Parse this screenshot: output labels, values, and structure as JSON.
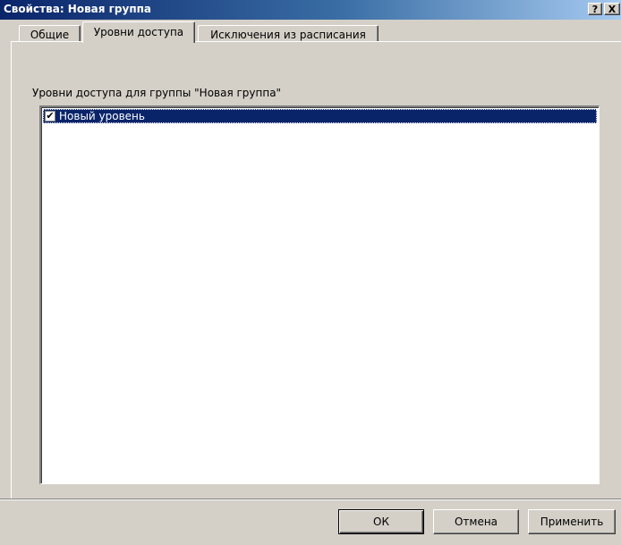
{
  "window": {
    "title": "Свойства: Новая группа",
    "help_label": "?",
    "close_label": "X"
  },
  "tabs": [
    {
      "label": "Общие",
      "active": false
    },
    {
      "label": "Уровни доступа",
      "active": true
    },
    {
      "label": "Исключения из расписания",
      "active": false
    }
  ],
  "panel": {
    "label": "Уровни доступа для группы \"Новая группа\"",
    "items": [
      {
        "label": "Новый уровень",
        "checked": true,
        "selected": true
      }
    ]
  },
  "buttons": {
    "ok": "ОК",
    "cancel": "Отмена",
    "apply": "Применить"
  },
  "colors": {
    "titlebar": "#0a246a",
    "selection": "#0a246a",
    "face": "#d4d0c8"
  }
}
